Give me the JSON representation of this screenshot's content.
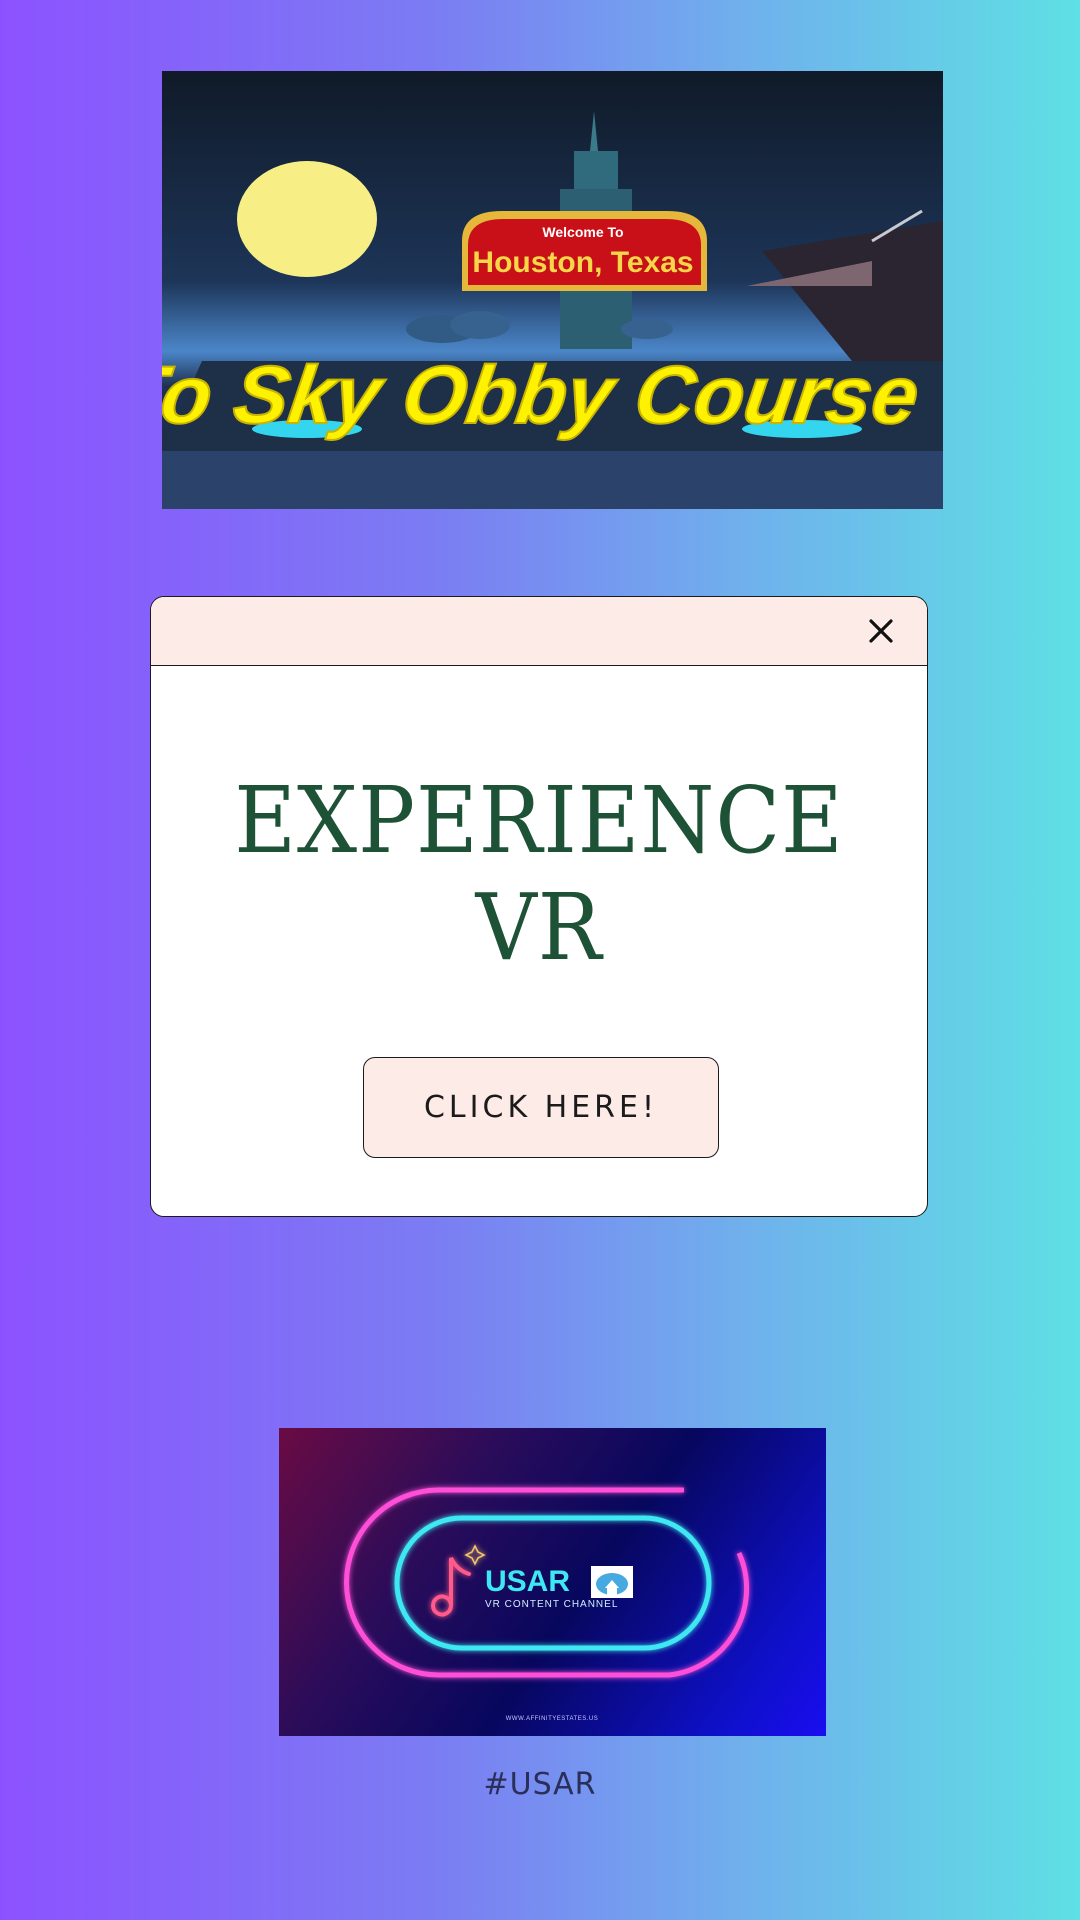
{
  "banner": {
    "sign_small": "Welcome To",
    "sign_large": "Houston, Texas",
    "headline": "To Sky Obby Course"
  },
  "dialog": {
    "title": "EXPERIENCE VR",
    "button_label": "CLICK HERE!"
  },
  "logo": {
    "brand": "USAR",
    "tagline": "VR CONTENT CHANNEL",
    "url": "WWW.AFFINITYESTATES.US"
  },
  "hashtag": "#USAR",
  "colors": {
    "dialog_header_bg": "#fdebe8",
    "title_color": "#1e5236",
    "neon_pink": "#ff4fd8",
    "neon_cyan": "#3ee8f2"
  },
  "icons": {
    "close": "close-icon",
    "music": "music-note-icon",
    "house": "house-icon"
  }
}
